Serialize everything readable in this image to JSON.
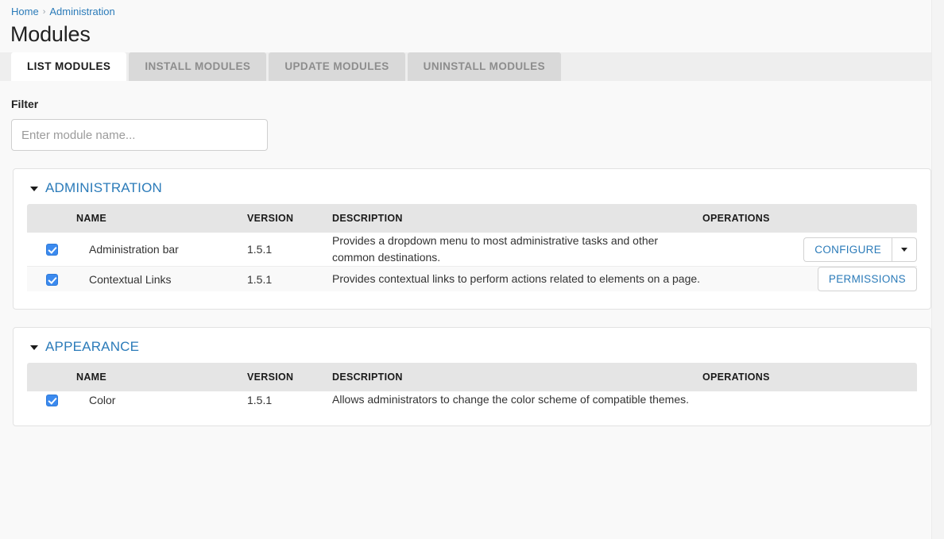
{
  "breadcrumb": {
    "items": [
      {
        "label": "Home"
      },
      {
        "label": "Administration"
      }
    ],
    "separator": "›"
  },
  "page": {
    "title": "Modules"
  },
  "tabs": [
    {
      "label": "LIST MODULES",
      "active": true
    },
    {
      "label": "INSTALL MODULES",
      "active": false
    },
    {
      "label": "UPDATE MODULES",
      "active": false
    },
    {
      "label": "UNINSTALL MODULES",
      "active": false
    }
  ],
  "filter": {
    "label": "Filter",
    "placeholder": "Enter module name...",
    "value": ""
  },
  "table_headers": {
    "name": "NAME",
    "version": "VERSION",
    "description": "DESCRIPTION",
    "operations": "OPERATIONS"
  },
  "groups": [
    {
      "title": "ADMINISTRATION",
      "expanded": true,
      "rows": [
        {
          "checked": true,
          "name": "Administration bar",
          "version": "1.5.1",
          "description": "Provides a dropdown menu to most administrative tasks and other common destinations.",
          "operations": {
            "primary": "CONFIGURE",
            "has_dropdown": true
          }
        },
        {
          "checked": true,
          "name": "Contextual Links",
          "version": "1.5.1",
          "description": "Provides contextual links to perform actions related to elements on a page.",
          "operations": {
            "primary": "PERMISSIONS",
            "has_dropdown": false
          }
        }
      ]
    },
    {
      "title": "APPEARANCE",
      "expanded": true,
      "rows": [
        {
          "checked": true,
          "name": "Color",
          "version": "1.5.1",
          "description": "Allows administrators to change the color scheme of compatible themes.",
          "operations": {
            "primary": "",
            "has_dropdown": false
          }
        }
      ]
    }
  ],
  "colors": {
    "link_blue": "#2b7bb9",
    "checkbox_blue": "#3b8aef",
    "tab_inactive_bg": "#d9d9d9",
    "tabstrip_bg": "#eeeeee",
    "table_header_bg": "#e5e5e5",
    "page_bg": "#f9f9f9"
  }
}
